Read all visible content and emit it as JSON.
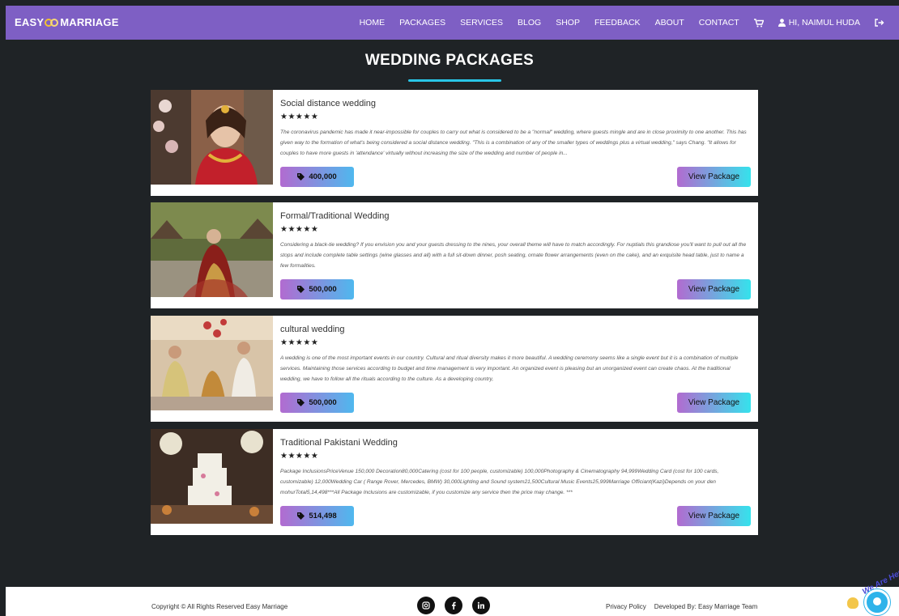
{
  "brand": {
    "left": "EASY",
    "right": "MARRIAGE"
  },
  "nav": {
    "links": [
      "HOME",
      "PACKAGES",
      "SERVICES",
      "BLOG",
      "SHOP",
      "FEEDBACK",
      "ABOUT",
      "CONTACT"
    ],
    "user": "HI, NAIMUL HUDA"
  },
  "page": {
    "title": "WEDDING PACKAGES"
  },
  "packages": [
    {
      "title": "Social distance wedding",
      "stars": "★★★★★",
      "description": "The coronavirus pandemic has made it near-impossible for couples to carry out what is considered to be a \"normal\" wedding, where guests mingle and are in close proximity to one another. This has given way to the formation of what's being considered a social distance wedding. \"This is a combination of any of the smaller types of weddings plus a virtual wedding,\" says Chang. \"It allows for couples to have more guests in 'attendance' virtually without increasing the size of the wedding and number of people in...",
      "price": "400,000",
      "button": "View Package"
    },
    {
      "title": "Formal/Traditional Wedding",
      "stars": "★★★★★",
      "description": "Considering a black-tie wedding? If you envision you and your guests dressing to the nines, your overall theme will have to match accordingly. For nuptials this grandiose you'll want to pull out all the stops and include complete table settings (wine glasses and all) with a full sit-down dinner, posh seating, ornate flower arrangements (even on the cake), and an exquisite head table, just to name a few formalities.",
      "price": "500,000",
      "button": "View Package"
    },
    {
      "title": "cultural wedding",
      "stars": "★★★★★",
      "description": "A wedding is one of the most important events in our country. Cultural and ritual diversity makes it more beautiful. A wedding ceremony seems like a single event but it is a combination of multiple services. Maintaining those services according to budget and time management is very important. An organized event is pleasing but an unorganized event can create chaos. At the traditional wedding, we have to follow all the rituals according to the culture. As a developing country,",
      "price": "500,000",
      "button": "View Package"
    },
    {
      "title": "Traditional Pakistani Wedding",
      "stars": "★★★★★",
      "description": "Package InclusionsPriceVenue 150,000 Decoration80,000Catering (cost for 100 people, customizable) 100,000Photography & Cinematography 94,999Wedding Card (cost for 100 cards, customizable) 12,000Wedding Car ( Range Rover, Mercedes, BMW) 30,000Lighting and Sound system21,500Cultural Music Events25,999Marriage Officiant(Kazi)Depends on your den mohurTotal5,14,498***All Package Inclusions are customizable, if you customize any service then the price may change. ***",
      "price": "514,498",
      "button": "View Package"
    }
  ],
  "footer": {
    "copyright": "Copyright © All Rights Reserved Easy Marriage",
    "socials": [
      "instagram-icon",
      "facebook-icon",
      "linkedin-icon"
    ],
    "privacy": "Privacy Policy",
    "developed": "Developed By: Easy Marriage Team"
  },
  "chat": {
    "label": "We Are Here!"
  }
}
